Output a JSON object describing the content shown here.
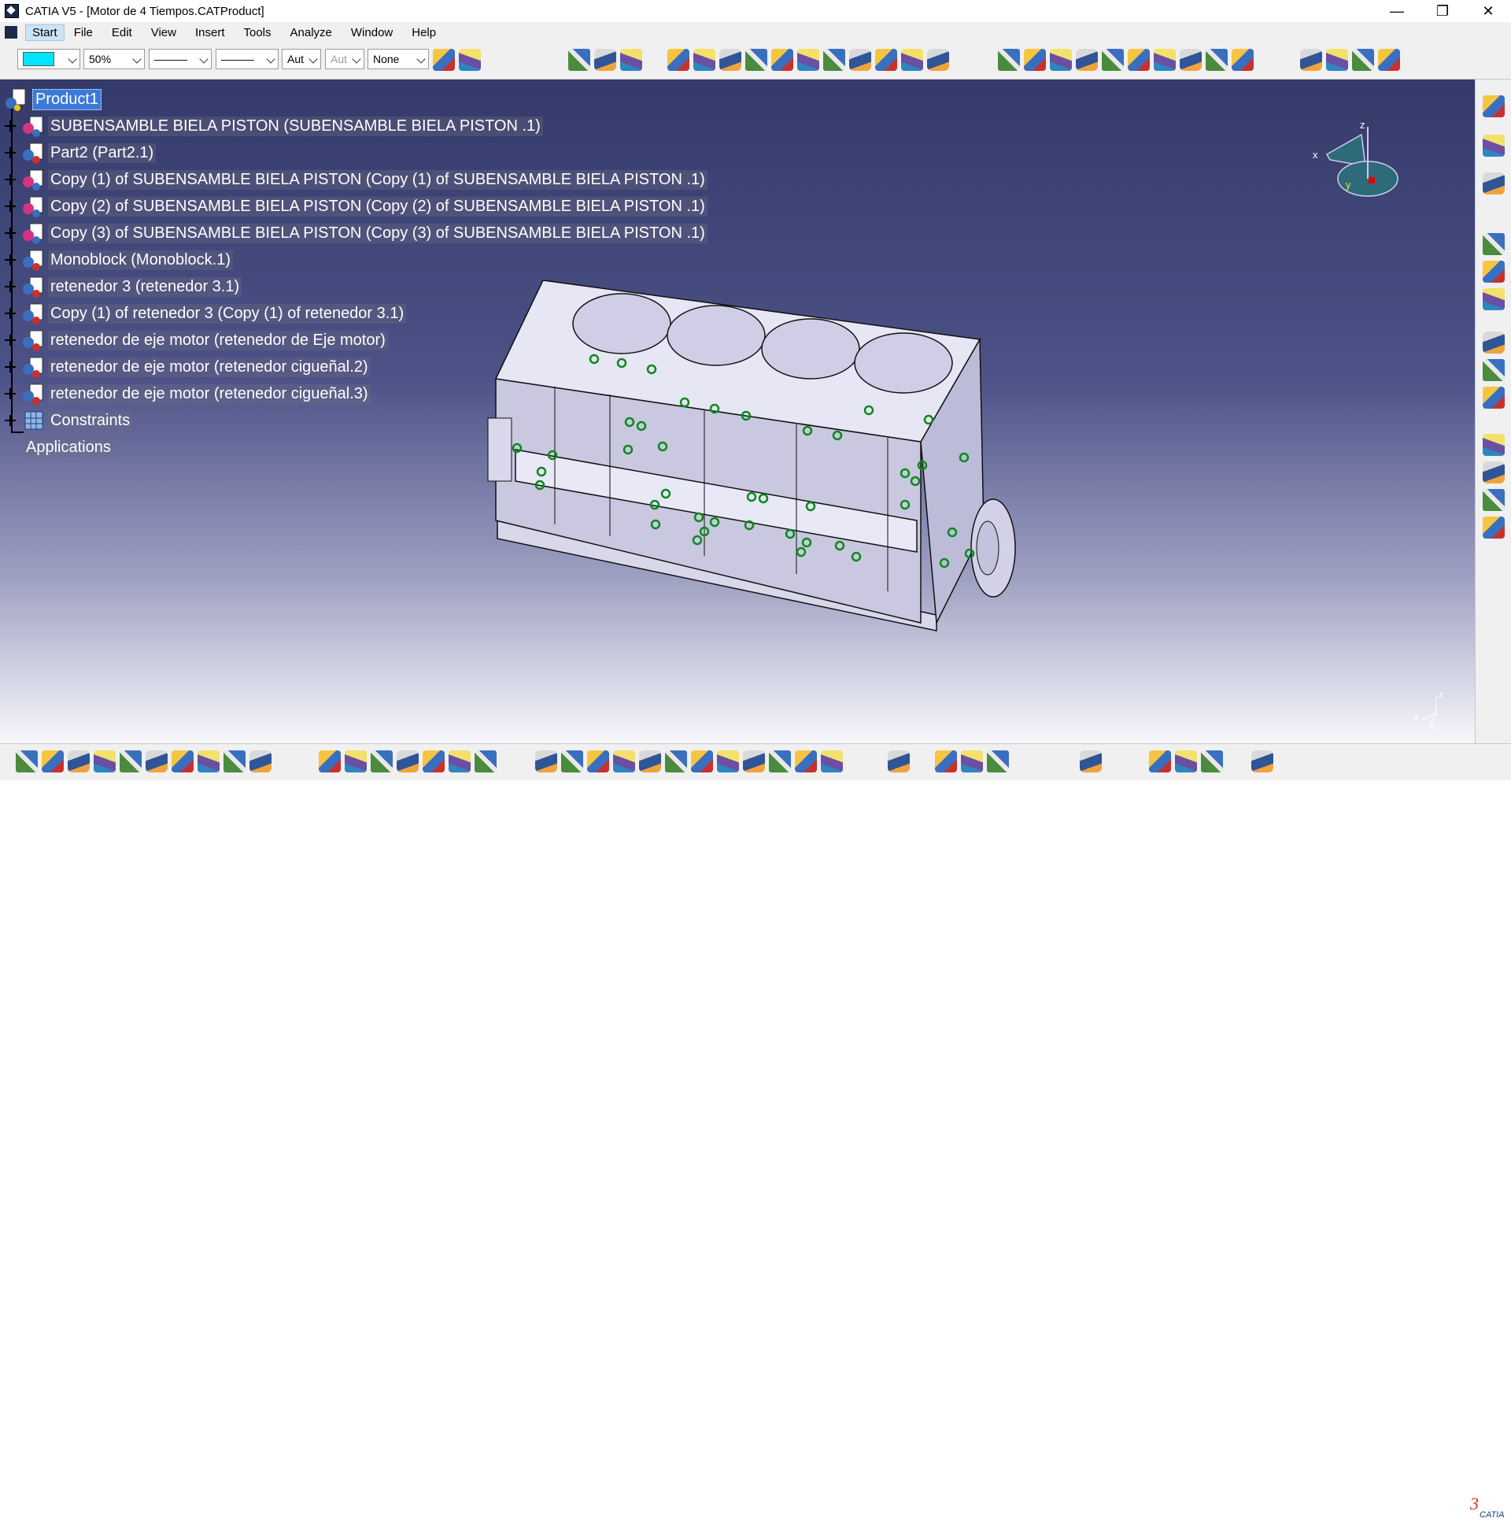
{
  "window": {
    "title": "CATIA V5 - [Motor de 4 Tiempos.CATProduct]",
    "minimize": "—",
    "restore": "❐",
    "close": "✕"
  },
  "menu": {
    "items": [
      "Start",
      "File",
      "Edit",
      "View",
      "Insert",
      "Tools",
      "Analyze",
      "Window",
      "Help"
    ]
  },
  "toolbar": {
    "zoom": "50%",
    "line_type": "———",
    "line_weight": "———",
    "aut1": "Aut",
    "aut2": "Aut",
    "layer": "None",
    "color_swatch": "#00e5ff"
  },
  "tree": {
    "root": "Product1",
    "nodes": [
      "SUBENSAMBLE BIELA PISTON  (SUBENSAMBLE BIELA PISTON .1)",
      "Part2 (Part2.1)",
      "Copy (1) of SUBENSAMBLE BIELA PISTON  (Copy (1) of SUBENSAMBLE BIELA PISTON .1)",
      "Copy (2) of SUBENSAMBLE BIELA PISTON  (Copy (2) of SUBENSAMBLE BIELA PISTON .1)",
      "Copy (3) of SUBENSAMBLE BIELA PISTON  (Copy (3) of SUBENSAMBLE BIELA PISTON .1)",
      "Monoblock (Monoblock.1)",
      "retenedor 3 (retenedor 3.1)",
      "Copy (1) of retenedor 3 (Copy (1) of retenedor 3.1)",
      "retenedor de eje motor (retenedor de Eje motor)",
      "retenedor de eje motor (retenedor cigueñal.2)",
      "retenedor de eje motor (retenedor cigueñal.3)",
      "Constraints"
    ],
    "applications": "Applications"
  },
  "compass": {
    "x": "x",
    "y": "y",
    "z": "z"
  },
  "axis": {
    "x": "x",
    "y": "y",
    "z": "z"
  },
  "colors": {
    "background_top": "#343a6a",
    "background_bottom": "#f7f7fb",
    "selection": "#3b7ad9",
    "constraint_green": "#0a8a1a"
  }
}
